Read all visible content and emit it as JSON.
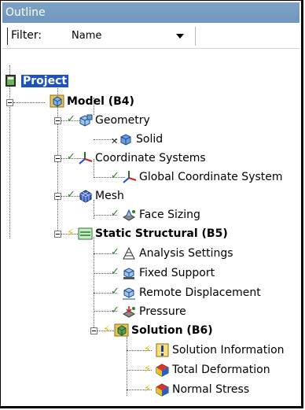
{
  "panel": {
    "title": "Outline"
  },
  "filter": {
    "label": "Filter:",
    "value": "Name"
  },
  "tree": {
    "project": "Project",
    "model": "Model (B4)",
    "geometry": "Geometry",
    "solid": "Solid",
    "coordinate_systems": "Coordinate Systems",
    "global_cs": "Global Coordinate System",
    "mesh": "Mesh",
    "face_sizing": "Face Sizing",
    "static_structural": "Static Structural (B5)",
    "analysis_settings": "Analysis Settings",
    "fixed_support": "Fixed Support",
    "remote_displacement": "Remote Displacement",
    "pressure": "Pressure",
    "solution": "Solution (B6)",
    "solution_information": "Solution Information",
    "total_deformation": "Total Deformation",
    "normal_stress": "Normal Stress"
  },
  "colors": {
    "titlebar": "#7fa3c6",
    "selection": "#1e50c8",
    "check": "#1a8a1a",
    "bolt": "#e6b800"
  }
}
